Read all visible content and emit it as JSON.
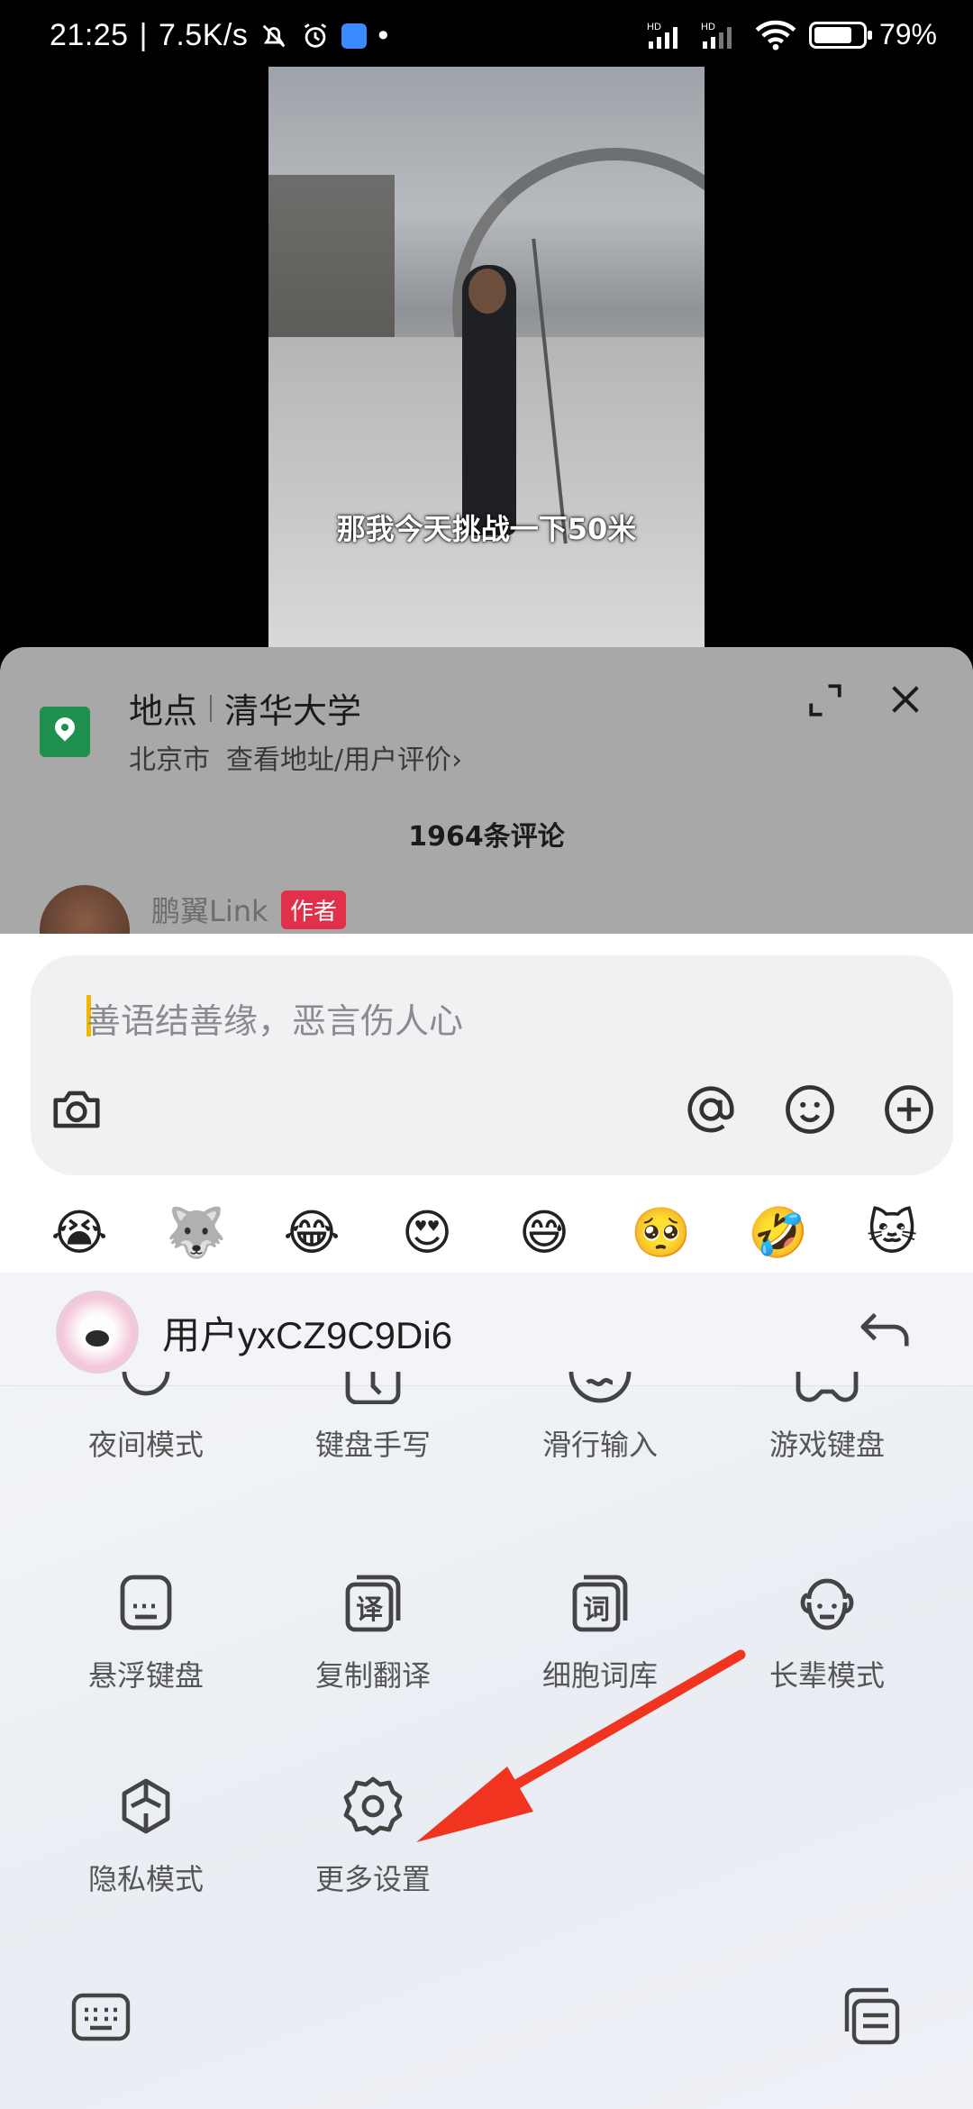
{
  "status_bar": {
    "time": "21:25",
    "sep": "|",
    "speed": "7.5K/s",
    "dot": "•",
    "battery_text": "79%",
    "battery_level": 0.79,
    "net1": "HD",
    "net2": "HD",
    "icons": [
      "bell-off-icon",
      "alarm-icon",
      "keyboard-app-icon",
      "signal-icon",
      "signal-icon",
      "wifi-icon",
      "battery-icon"
    ]
  },
  "video": {
    "subtitle": "那我今天挑战一下50米"
  },
  "location": {
    "label": "地点",
    "place": "清华大学",
    "city": "北京市",
    "link": "查看地址/用户评价",
    "chevron": "›"
  },
  "comments": {
    "count_label": "1964条评论",
    "first_author": "鹏翼Link",
    "author_badge": "作者"
  },
  "input": {
    "placeholder": "善语结善缘，恶言伤人心"
  },
  "emojis": [
    "😭",
    "🐺",
    "😂",
    "😍",
    "😅",
    "🥺",
    "🤣",
    "🐱"
  ],
  "keyboard": {
    "username": "用户yxCZ9C9Di6",
    "row1": [
      "夜间模式",
      "键盘手写",
      "滑行输入",
      "游戏键盘"
    ],
    "row2": [
      "悬浮键盘",
      "复制翻译",
      "细胞词库",
      "长辈模式"
    ],
    "row3": [
      "隐私模式",
      "更多设置"
    ],
    "icon_text": {
      "translate": "译",
      "lexicon": "词"
    }
  },
  "colors": {
    "accent_yellow": "#f2b600",
    "badge_red": "#e0304a",
    "location_green": "#1f8f4e",
    "annotation_arrow": "#f0341f"
  }
}
